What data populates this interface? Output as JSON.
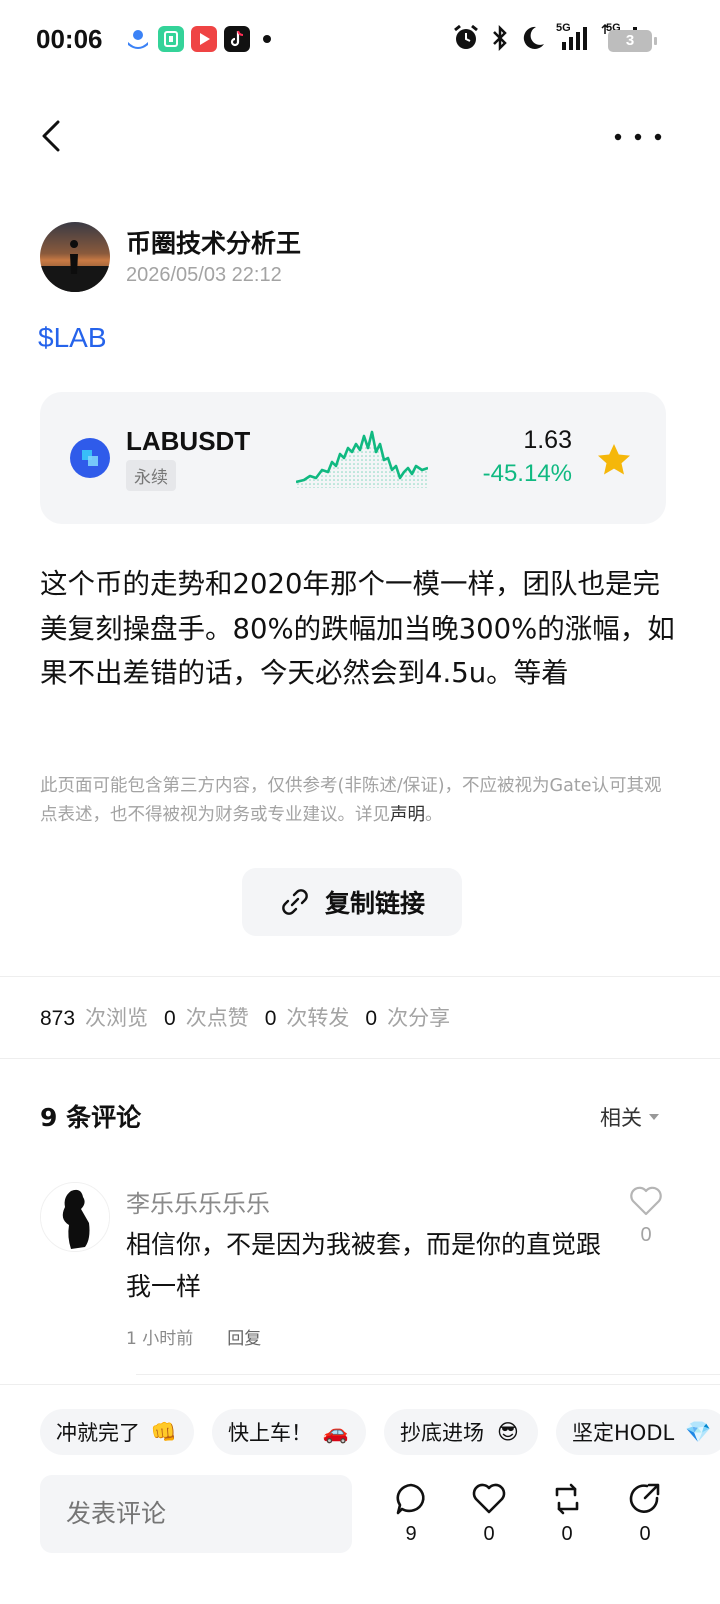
{
  "status_bar": {
    "time": "00:06",
    "network_1": "5G",
    "network_2": "5G",
    "battery": "3"
  },
  "author": {
    "name": "币圈技术分析王",
    "timestamp": "2026/05/03 22:12"
  },
  "post": {
    "tag": "$LAB",
    "body": "这个币的走势和2020年那个一模一样，团队也是完美复刻操盘手。80%的跌幅加当晚300%的涨幅，如果不出差错的话，今天必然会到4.5u。等着",
    "disclaimer_text": "此页面可能包含第三方内容，仅供参考(非陈述/保证)，不应被视为Gate认可其观点表述，也不得被视为财务或专业建议。详见",
    "disclaimer_link": "声明",
    "disclaimer_end": "。"
  },
  "ticker": {
    "symbol": "LABUSDT",
    "type": "永续",
    "price": "1.63",
    "change": "-45.14%",
    "trend_color": "#10b981",
    "favorite_color": "#f5b70a"
  },
  "copy_link": {
    "label": "复制链接"
  },
  "stats": [
    {
      "value": "873",
      "label": "次浏览"
    },
    {
      "value": "0",
      "label": "次点赞"
    },
    {
      "value": "0",
      "label": "次转发"
    },
    {
      "value": "0",
      "label": "次分享"
    }
  ],
  "comments_section": {
    "title": "9 条评论",
    "sort_label": "相关"
  },
  "comments": [
    {
      "user": "李乐乐乐乐乐",
      "text": "相信你，不是因为我被套，而是你的直觉跟我一样",
      "time": "1 小时前",
      "reply_label": "回复",
      "likes": "0"
    }
  ],
  "quick_replies": [
    {
      "label": "冲就完了",
      "emoji": "👊"
    },
    {
      "label": "快上车！",
      "emoji": "🚗"
    },
    {
      "label": "抄底进场",
      "emoji": "😎"
    },
    {
      "label": "坚定HODL",
      "emoji": "💎"
    }
  ],
  "bottom_bar": {
    "input_placeholder": "发表评论",
    "comment_count": "9",
    "like_count": "0",
    "repost_count": "0",
    "share_count": "0"
  }
}
